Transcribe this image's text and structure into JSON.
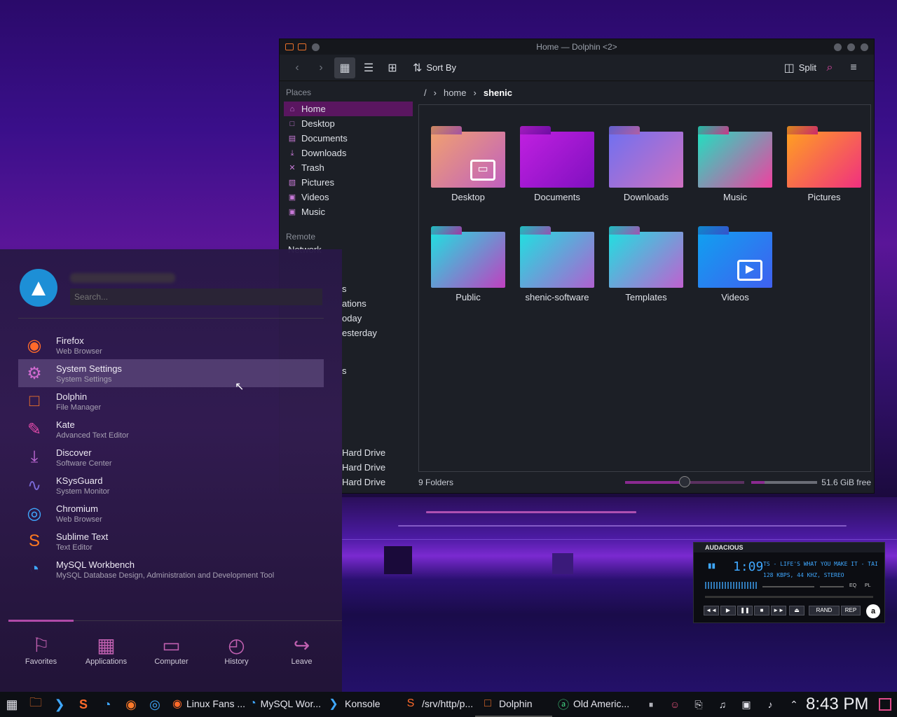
{
  "dolphin": {
    "title": "Home — Dolphin <2>",
    "toolbar": {
      "sort_label": "Sort By",
      "split_label": "Split"
    },
    "places_header": "Places",
    "places": [
      "Home",
      "Desktop",
      "Documents",
      "Downloads",
      "Trash",
      "Pictures",
      "Videos",
      "Music"
    ],
    "remote_header": "Remote",
    "remote_partial": "Network",
    "breadcrumb": [
      "/",
      "home",
      "shenic"
    ],
    "folders": [
      "Desktop",
      "Documents",
      "Downloads",
      "Music",
      "Pictures",
      "Public",
      "shenic-software",
      "Templates",
      "Videos"
    ],
    "status_text": "9 Folders",
    "free_space": "51.6 GiB free",
    "zoom_level": 0.5,
    "used_fraction": 0.2
  },
  "sidebar_partial": {
    "items1": [
      "s",
      "ations",
      "oday",
      "esterday",
      "s"
    ],
    "drives": [
      "Hard Drive",
      "Hard Drive",
      "Hard Drive"
    ]
  },
  "menu": {
    "search_placeholder": "Search...",
    "apps": [
      {
        "name": "Firefox",
        "desc": "Web Browser",
        "icon": "firefox-icon"
      },
      {
        "name": "System Settings",
        "desc": "System Settings",
        "icon": "gear-icon"
      },
      {
        "name": "Dolphin",
        "desc": "File Manager",
        "icon": "folder-icon"
      },
      {
        "name": "Kate",
        "desc": "Advanced Text Editor",
        "icon": "edit-icon"
      },
      {
        "name": "Discover",
        "desc": "Software Center",
        "icon": "download-icon"
      },
      {
        "name": "KSysGuard",
        "desc": "System Monitor",
        "icon": "monitor-icon"
      },
      {
        "name": "Chromium",
        "desc": "Web Browser",
        "icon": "chromium-icon"
      },
      {
        "name": "Sublime Text",
        "desc": "Text Editor",
        "icon": "sublime-icon"
      },
      {
        "name": "MySQL Workbench",
        "desc": "MySQL Database Design, Administration and Development Tool",
        "icon": "mysql-icon"
      }
    ],
    "tabs": [
      "Favorites",
      "Applications",
      "Computer",
      "History",
      "Leave"
    ]
  },
  "audacious": {
    "title": "AUDACIOUS",
    "time": "1:09",
    "track": "TS - LIFE'S WHAT YOU MAKE IT - TAI",
    "info": "128 KBPS, 44 KHZ, STEREO",
    "eq_label": "EQ",
    "pl_label": "PL",
    "rand": "RAND",
    "rep": "REP"
  },
  "taskbar": {
    "tasks": [
      "Linux Fans ...",
      "MySQL Wor...",
      "Konsole",
      "/srv/http/p...",
      "Dolphin",
      "Old Americ..."
    ],
    "clock": "8:43 PM"
  },
  "colors": {
    "accent": "#c04aa8",
    "selection": "#5a1660",
    "audacious_text": "#3fa8ff"
  }
}
